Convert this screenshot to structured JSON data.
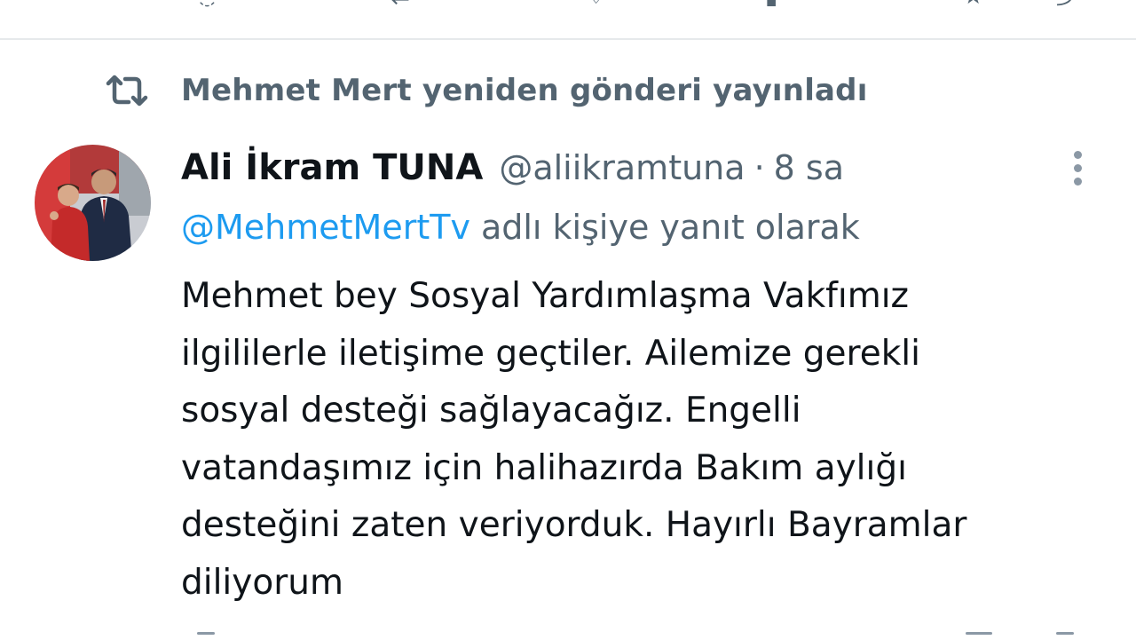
{
  "top_actions": {
    "icons": [
      "reply-icon",
      "retweet-icon",
      "like-icon",
      "views-icon",
      "bookmark-icon",
      "share-icon"
    ]
  },
  "retweet_header": {
    "icon": "retweet-icon",
    "text": "Mehmet Mert yeniden gönderi yayınladı"
  },
  "tweet": {
    "avatar_icon": "profile-photo",
    "display_name": "Ali İkram TUNA",
    "handle": "@aliikramtuna",
    "separator": "·",
    "time": "8 sa",
    "reply_to_mention": "@MehmetMertTv",
    "reply_to_suffix": "adlı kişiye yanıt olarak",
    "body_lines": [
      "Mehmet bey Sosyal Yardımlaşma Vakfımız",
      "ilgililerle iletişime geçtiler. Ailemize gerekli",
      "sosyal desteği sağlayacağız. Engelli",
      "vatandaşımız için halihazırda Bakım aylığı",
      "desteğini zaten veriyorduk. Hayırlı Bayramlar",
      "diliyorum"
    ]
  },
  "colors": {
    "text_primary": "#0f1419",
    "text_secondary": "#536471",
    "link": "#1d9bf0",
    "divider": "#e6e9eb"
  }
}
